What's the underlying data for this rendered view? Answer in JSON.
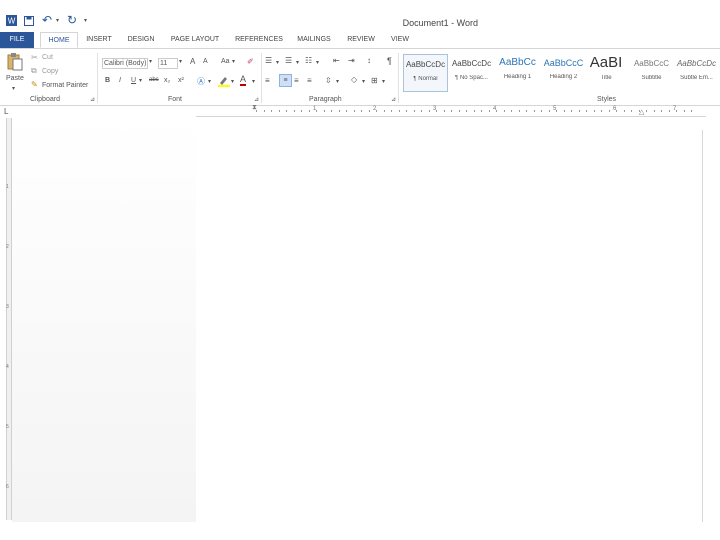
{
  "window": {
    "title": "Document1 - Word"
  },
  "quick_access": {
    "word_icon": "word-logo-icon",
    "save_icon": "save-icon",
    "undo_icon": "undo-icon",
    "redo_icon": "redo-icon",
    "customize_icon": "chevron-down-icon"
  },
  "tabs": [
    {
      "label": "FILE"
    },
    {
      "label": "HOME"
    },
    {
      "label": "INSERT"
    },
    {
      "label": "DESIGN"
    },
    {
      "label": "PAGE LAYOUT"
    },
    {
      "label": "REFERENCES"
    },
    {
      "label": "MAILINGS"
    },
    {
      "label": "REVIEW"
    },
    {
      "label": "VIEW"
    }
  ],
  "clipboard": {
    "paste": "Paste",
    "cut": "Cut",
    "copy": "Copy",
    "format_painter": "Format Painter",
    "group": "Clipboard"
  },
  "font": {
    "name": "Calibri (Body)",
    "size": "11",
    "bold": "B",
    "italic": "I",
    "underline": "U",
    "strike": "abc",
    "subscript": "x₂",
    "superscript": "x²",
    "grow": "A",
    "shrink": "A",
    "case": "Aa",
    "color_a": "A",
    "group": "Font"
  },
  "paragraph": {
    "pilcrow": "¶",
    "group": "Paragraph"
  },
  "styles": {
    "items": [
      {
        "preview": "AaBbCcDc",
        "name": "¶ Normal"
      },
      {
        "preview": "AaBbCcDc",
        "name": "¶ No Spac..."
      },
      {
        "preview": "AaBbCc",
        "name": "Heading 1"
      },
      {
        "preview": "AaBbCcC",
        "name": "Heading 2"
      },
      {
        "preview": "AaBI",
        "name": "Title"
      },
      {
        "preview": "AaBbCcC",
        "name": "Subtitle"
      },
      {
        "preview": "AaBbCcDc",
        "name": "Subtle Em..."
      }
    ],
    "group": "Styles"
  },
  "ruler": {
    "corner": "L",
    "numbers": [
      "1",
      "2",
      "3",
      "4",
      "5",
      "6",
      "7"
    ],
    "vertical_numbers": [
      "1",
      "2",
      "3",
      "4",
      "5",
      "6"
    ]
  },
  "colors": {
    "accent": "#2b579a",
    "highlight": "#ffff00",
    "font_color": "#c00000"
  }
}
